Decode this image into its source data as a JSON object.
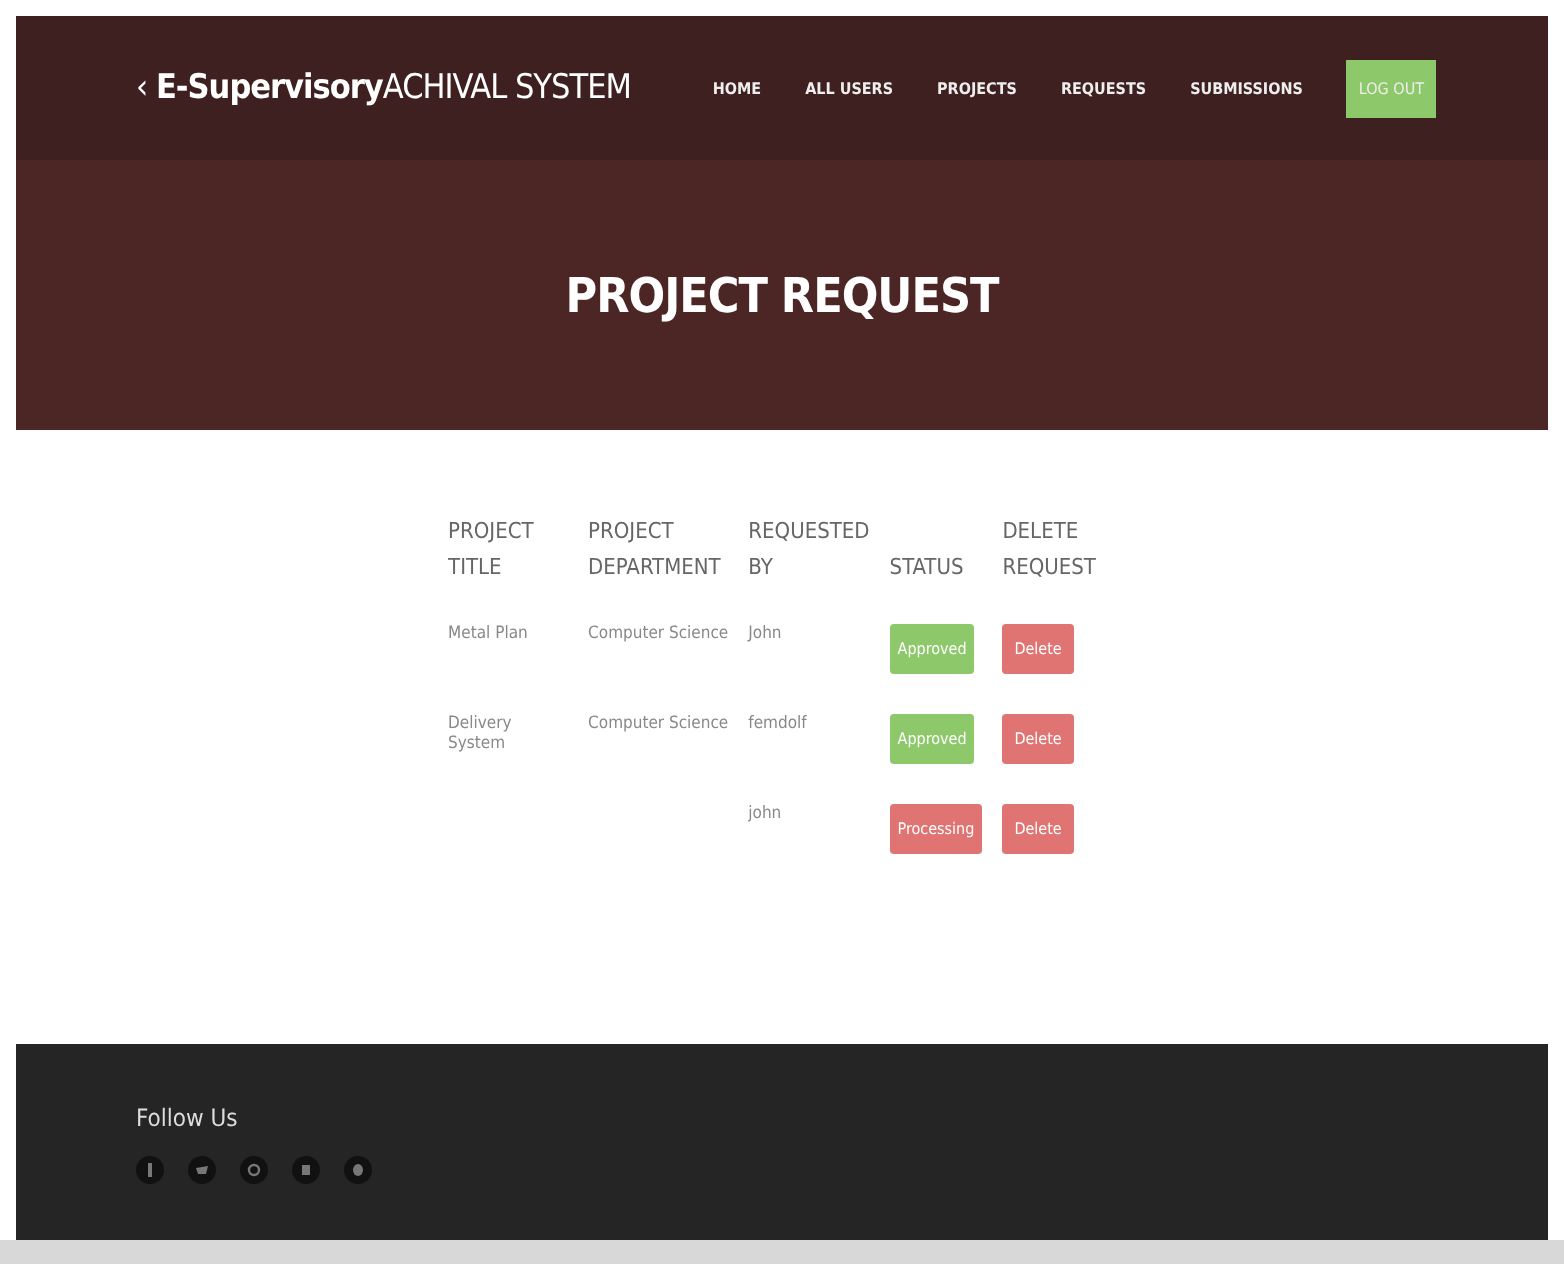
{
  "navbar": {
    "brand_icon": "‹",
    "brand_bold": "E-Supervisory",
    "brand_rest": "ACHIVAL SYSTEM",
    "links": [
      {
        "label": "HOME",
        "kind": "link"
      },
      {
        "label": "ALL USERS",
        "kind": "link"
      },
      {
        "label": "PROJECTS",
        "kind": "link"
      },
      {
        "label": "REQUESTS",
        "kind": "link"
      },
      {
        "label": "SUBMISSIONS",
        "kind": "link"
      },
      {
        "label": "LOG OUT",
        "kind": "button"
      }
    ]
  },
  "hero": {
    "title": "PROJECT REQUEST"
  },
  "table": {
    "columns": [
      [
        "PROJECT",
        "TITLE"
      ],
      [
        "PROJECT",
        "DEPARTMENT"
      ],
      [
        "REQUESTED",
        "BY"
      ],
      [
        "STATUS"
      ],
      [
        "DELETE",
        "REQUEST"
      ]
    ],
    "rows": [
      {
        "title": "Metal Plan",
        "department": "Computer Science",
        "requested_by": "John",
        "status": {
          "label": "Approved",
          "kind": "approved"
        },
        "action": "Delete"
      },
      {
        "title": "Delivery System",
        "department": "Computer Science",
        "requested_by": "femdolf",
        "status": {
          "label": "Approved",
          "kind": "approved"
        },
        "action": "Delete"
      },
      {
        "requested_by": "john",
        "status": {
          "label": "Processing",
          "kind": "pending"
        },
        "action": "Delete"
      }
    ]
  },
  "footer": {
    "heading": "Follow Us",
    "social_icons": [
      {
        "kind": "facebook"
      },
      {
        "kind": "twitter"
      },
      {
        "kind": "google"
      },
      {
        "kind": "linkedin"
      },
      {
        "kind": "skype"
      }
    ]
  }
}
